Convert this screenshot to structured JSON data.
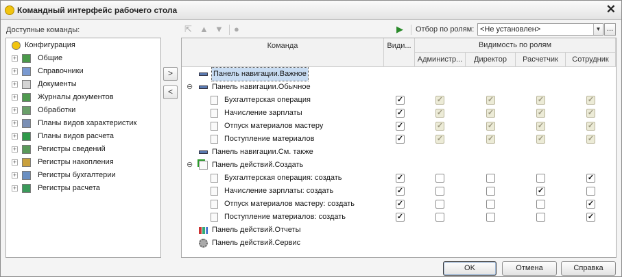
{
  "window": {
    "title": "Командный интерфейс рабочего стола",
    "close_glyph": "✕"
  },
  "left": {
    "label": "Доступные команды:",
    "items": [
      {
        "label": "Конфигурация",
        "icon": "config-icon"
      },
      {
        "label": "Общие",
        "icon": "common-icon"
      },
      {
        "label": "Справочники",
        "icon": "catalogs-icon"
      },
      {
        "label": "Документы",
        "icon": "documents-icon"
      },
      {
        "label": "Журналы документов",
        "icon": "journals-icon"
      },
      {
        "label": "Обработки",
        "icon": "processings-icon"
      },
      {
        "label": "Планы видов характеристик",
        "icon": "char-types-icon"
      },
      {
        "label": "Планы видов расчета",
        "icon": "calc-types-icon"
      },
      {
        "label": "Регистры сведений",
        "icon": "info-registers-icon"
      },
      {
        "label": "Регистры накопления",
        "icon": "accum-registers-icon"
      },
      {
        "label": "Регистры бухгалтерии",
        "icon": "accounting-registers-icon"
      },
      {
        "label": "Регистры расчета",
        "icon": "calc-registers-icon"
      }
    ]
  },
  "move_buttons": {
    "add": ">",
    "remove": "<"
  },
  "toolbar": {
    "filter_label": "Отбор по ролям:",
    "filter_value": "<Не установлен>",
    "dots": "..."
  },
  "grid": {
    "headers": {
      "command": "Команда",
      "visible": "Види...",
      "roles_group": "Видимость по ролям"
    },
    "roles": [
      "Администр...",
      "Директор",
      "Расчетчик",
      "Сотрудник"
    ],
    "rows": [
      {
        "label": "Панель навигации.Важное",
        "level": 0,
        "icon": "nav-panel-icon",
        "group": true,
        "selected": true
      },
      {
        "label": "Панель навигации.Обычное",
        "level": 0,
        "icon": "nav-panel-icon",
        "group": true,
        "expanded": true
      },
      {
        "label": "Бухгалтерская операция",
        "level": 1,
        "icon": "document-icon",
        "visible": true,
        "roles": [
          true,
          true,
          true,
          true
        ],
        "roles_disabled": true
      },
      {
        "label": "Начисление зарплаты",
        "level": 1,
        "icon": "document-icon",
        "visible": true,
        "roles": [
          true,
          true,
          true,
          true
        ],
        "roles_disabled": true
      },
      {
        "label": "Отпуск материалов мастеру",
        "level": 1,
        "icon": "document-icon",
        "visible": true,
        "roles": [
          true,
          true,
          true,
          true
        ],
        "roles_disabled": true
      },
      {
        "label": "Поступление материалов",
        "level": 1,
        "icon": "document-icon",
        "visible": true,
        "roles": [
          true,
          true,
          true,
          true
        ],
        "roles_disabled": true
      },
      {
        "label": "Панель навигации.См. также",
        "level": 0,
        "icon": "nav-panel-icon",
        "group": true
      },
      {
        "label": "Панель действий.Создать",
        "level": 0,
        "icon": "create-icon",
        "group": true,
        "expanded": true
      },
      {
        "label": "Бухгалтерская операция: создать",
        "level": 1,
        "icon": "document-icon",
        "visible": true,
        "roles": [
          false,
          false,
          false,
          true
        ]
      },
      {
        "label": "Начисление зарплаты: создать",
        "level": 1,
        "icon": "document-icon",
        "visible": true,
        "roles": [
          false,
          false,
          true,
          false
        ]
      },
      {
        "label": "Отпуск материалов мастеру: создать",
        "level": 1,
        "icon": "document-icon",
        "visible": true,
        "roles": [
          false,
          false,
          false,
          true
        ]
      },
      {
        "label": "Поступление материалов: создать",
        "level": 1,
        "icon": "document-icon",
        "visible": true,
        "roles": [
          false,
          false,
          false,
          true
        ]
      },
      {
        "label": "Панель действий.Отчеты",
        "level": 0,
        "icon": "reports-icon",
        "group": true
      },
      {
        "label": "Панель действий.Сервис",
        "level": 0,
        "icon": "service-gear-icon",
        "group": true
      }
    ]
  },
  "footer": {
    "ok": "OK",
    "cancel": "Отмена",
    "help": "Справка"
  }
}
